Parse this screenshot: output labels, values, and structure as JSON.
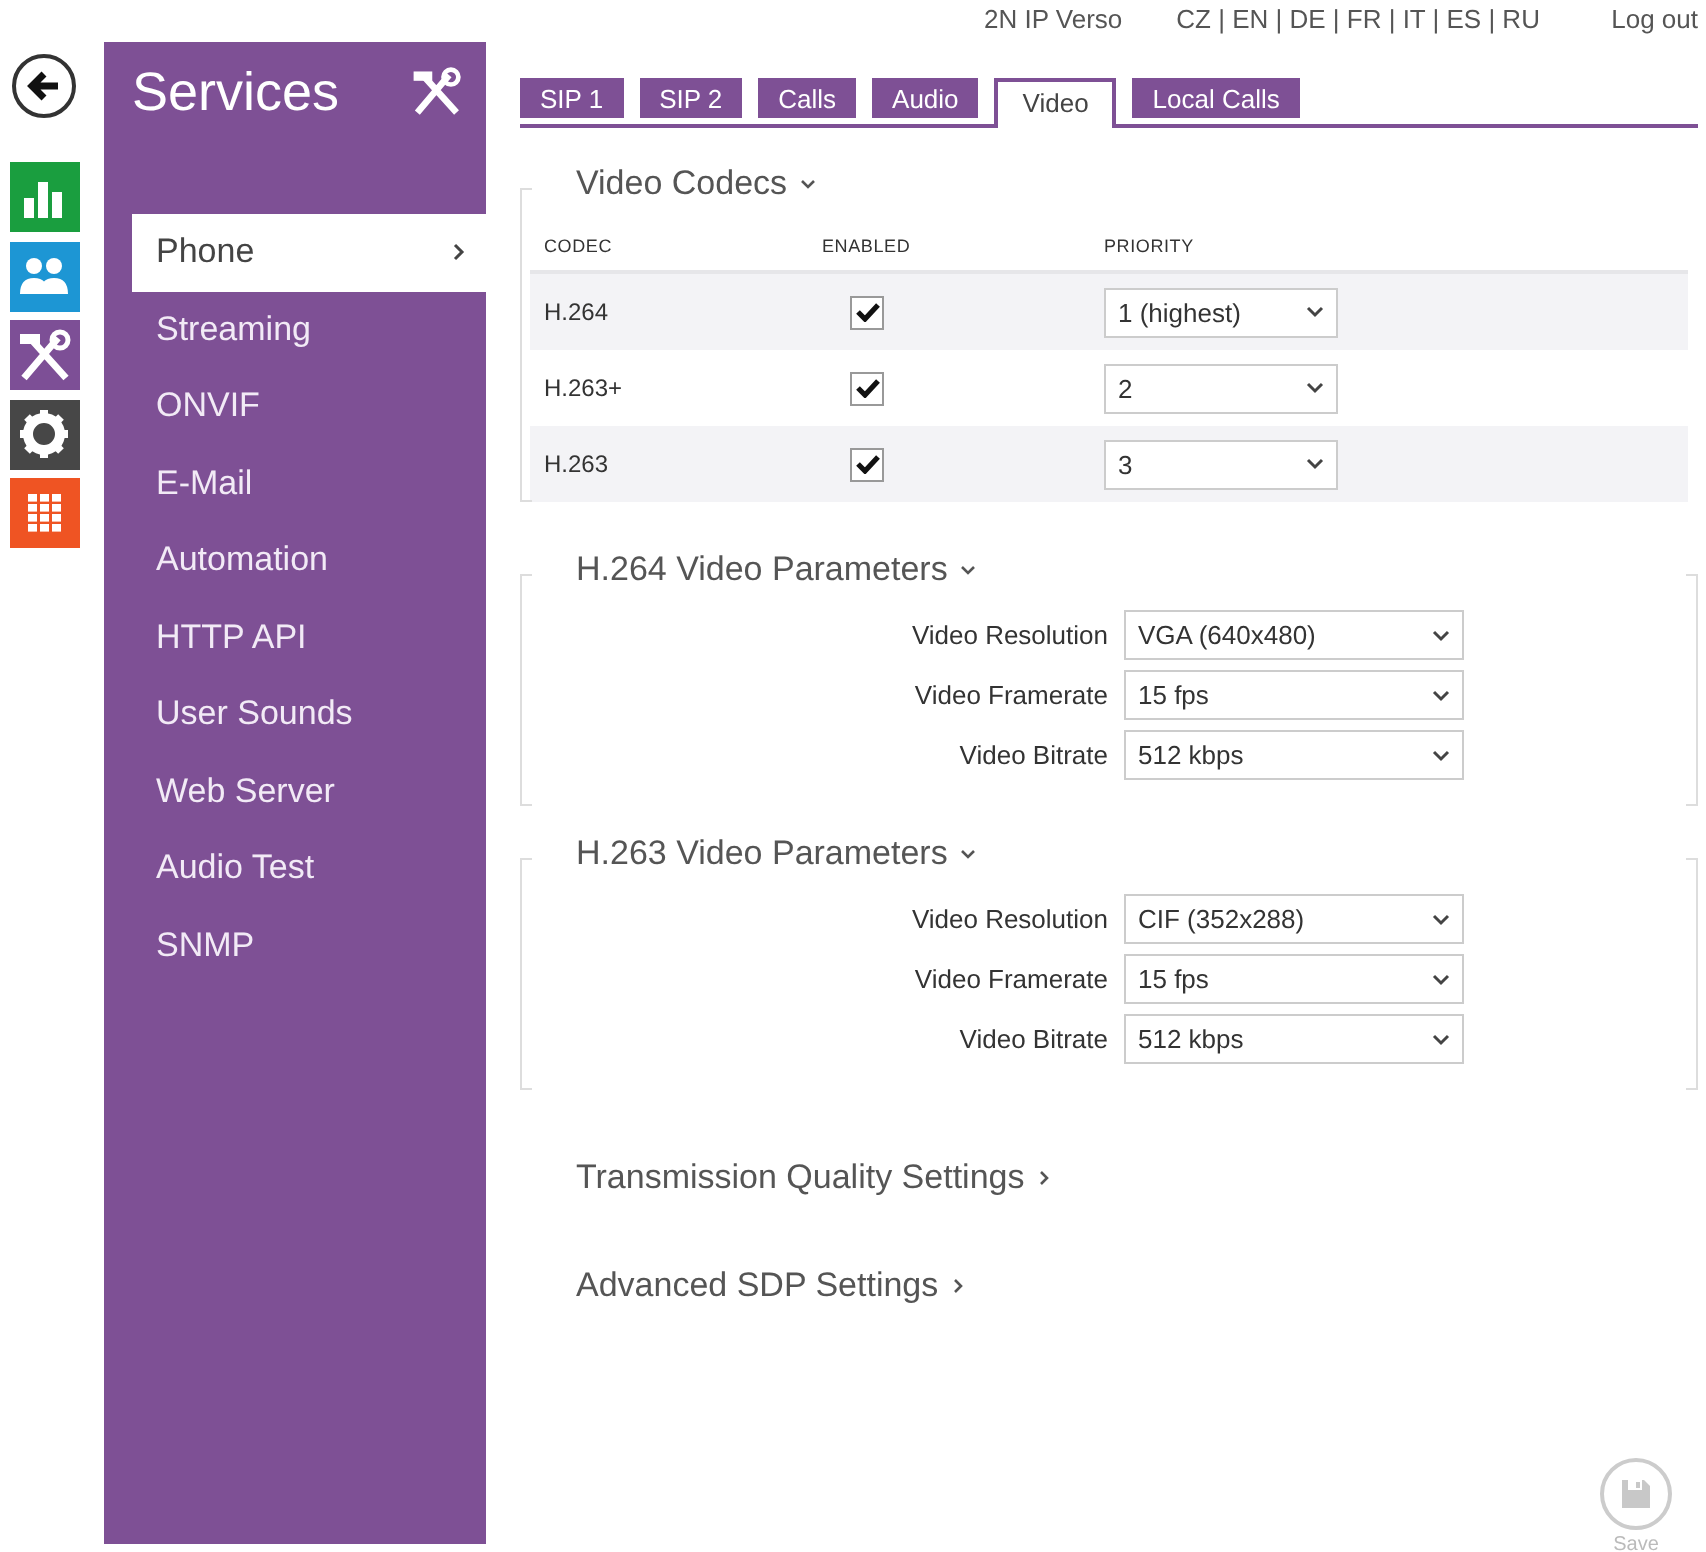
{
  "header": {
    "device": "2N IP Verso",
    "languages": "CZ | EN | DE | FR | IT | ES | RU",
    "logout": "Log out"
  },
  "rail": [
    {
      "kind": "back"
    },
    {
      "kind": "chart",
      "color": "#1a9e3f"
    },
    {
      "kind": "users",
      "color": "#1d96d4"
    },
    {
      "kind": "tools",
      "color": "#7d4f96"
    },
    {
      "kind": "gear",
      "color": "#474747"
    },
    {
      "kind": "grid",
      "color": "#ef5423"
    }
  ],
  "sidebar": {
    "title": "Services",
    "items": [
      {
        "label": "Phone",
        "selected": true
      },
      {
        "label": "Streaming",
        "selected": false
      },
      {
        "label": "ONVIF",
        "selected": false
      },
      {
        "label": "E-Mail",
        "selected": false
      },
      {
        "label": "Automation",
        "selected": false
      },
      {
        "label": "HTTP API",
        "selected": false
      },
      {
        "label": "User Sounds",
        "selected": false
      },
      {
        "label": "Web Server",
        "selected": false
      },
      {
        "label": "Audio Test",
        "selected": false
      },
      {
        "label": "SNMP",
        "selected": false
      }
    ]
  },
  "tabs": [
    {
      "label": "SIP 1",
      "selected": false
    },
    {
      "label": "SIP 2",
      "selected": false
    },
    {
      "label": "Calls",
      "selected": false
    },
    {
      "label": "Audio",
      "selected": false
    },
    {
      "label": "Video",
      "selected": true
    },
    {
      "label": "Local Calls",
      "selected": false
    }
  ],
  "codecs": {
    "title": "Video Codecs",
    "expanded": true,
    "columns": [
      "CODEC",
      "ENABLED",
      "PRIORITY"
    ],
    "rows": [
      {
        "codec": "H.264",
        "enabled": true,
        "priority": "1 (highest)"
      },
      {
        "codec": "H.263+",
        "enabled": true,
        "priority": "2"
      },
      {
        "codec": "H.263",
        "enabled": true,
        "priority": "3"
      }
    ]
  },
  "parameter_sections": [
    {
      "title": "H.264 Video Parameters",
      "expanded": true,
      "fields": [
        {
          "label": "Video Resolution",
          "value": "VGA (640x480)"
        },
        {
          "label": "Video Framerate",
          "value": "15 fps"
        },
        {
          "label": "Video Bitrate",
          "value": "512 kbps"
        }
      ]
    },
    {
      "title": "H.263 Video Parameters",
      "expanded": true,
      "fields": [
        {
          "label": "Video Resolution",
          "value": "CIF (352x288)"
        },
        {
          "label": "Video Framerate",
          "value": "15 fps"
        },
        {
          "label": "Video Bitrate",
          "value": "512 kbps"
        }
      ]
    },
    {
      "title": "Transmission Quality Settings",
      "expanded": false
    },
    {
      "title": "Advanced SDP Settings",
      "expanded": false
    }
  ],
  "save": {
    "label": "Save",
    "disabled": true
  }
}
